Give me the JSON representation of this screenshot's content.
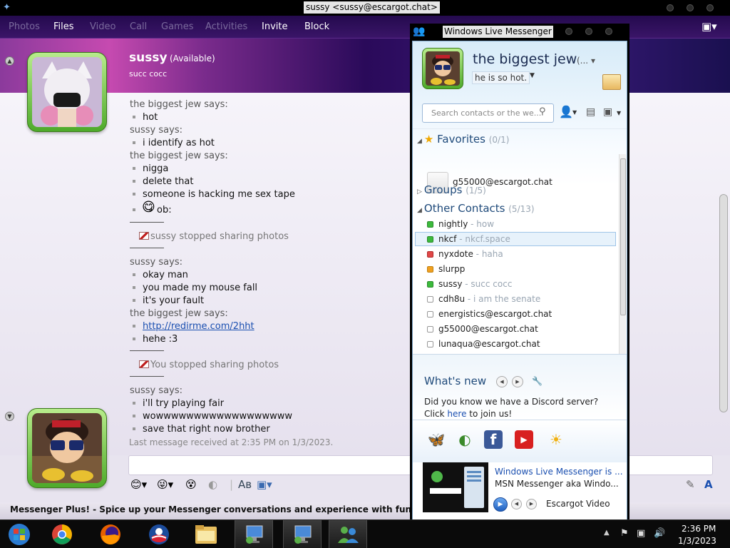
{
  "chat_window": {
    "title": "sussy <sussy@escargot.chat>",
    "menu": [
      "Photos",
      "Files",
      "Video",
      "Call",
      "Games",
      "Activities",
      "Invite",
      "Block"
    ],
    "contact": {
      "name": "sussy",
      "status": "(Available)",
      "psm": "succ cocc"
    },
    "messages": {
      "s1": "the biggest jew says:",
      "m1": "hot",
      "s2": "sussy says:",
      "m2": "i identify as hot",
      "s3": "the biggest jew says:",
      "m3": "nigga",
      "m4": "delete that",
      "m5": "someone is hacking me sex tape",
      "m6": "ob:",
      "sys1": "sussy stopped sharing photos",
      "s4": "sussy says:",
      "m7": "okay man",
      "m8": "you made my mouse fall",
      "m9": "it's your fault",
      "s5": "the biggest jew says:",
      "m10": "http://redirme.com/2hht",
      "m11": "hehe :3",
      "sys2": "You stopped sharing photos",
      "s6": "sussy says:",
      "m12": "i'll try playing fair",
      "m13": "wowwwwwwwwwwwwwwwwww",
      "m14": "save that right now brother"
    },
    "last_message": "Last message received at 2:35 PM on 1/3/2023.",
    "plus_bar": "Messenger Plus! - Spice up your Messenger conversations and experience with fun features"
  },
  "wlm": {
    "title": "Windows Live Messenger",
    "user": {
      "display_name": "the biggest jew",
      "status_short": "(...",
      "psm": "he is so hot."
    },
    "search_placeholder": "Search contacts or the we...",
    "groups": {
      "favorites": {
        "label": "Favorites",
        "count": "(0/1)"
      },
      "groups": {
        "label": "Groups",
        "count": "(1/5)"
      },
      "other": {
        "label": "Other Contacts",
        "count": "(5/13)"
      }
    },
    "favorite_contact": "g55000@escargot.chat",
    "contacts": [
      {
        "name": "nightly",
        "psm": " - how",
        "status": "online"
      },
      {
        "name": "nkcf",
        "psm": " - nkcf.space",
        "status": "online"
      },
      {
        "name": "nyxdote",
        "psm": " - haha",
        "status": "busy"
      },
      {
        "name": "slurpp",
        "psm": "",
        "status": "away"
      },
      {
        "name": "sussy",
        "psm": " - succ cocc",
        "status": "online"
      },
      {
        "name": "cdh8u",
        "psm": " - i am the senate",
        "status": "offline"
      },
      {
        "name": "energistics@escargot.chat",
        "psm": "",
        "status": "offline"
      },
      {
        "name": "g55000@escargot.chat",
        "psm": "",
        "status": "offline"
      },
      {
        "name": "lunaqua@escargot.chat",
        "psm": "",
        "status": "offline"
      }
    ],
    "whats_new": {
      "title": "What's new",
      "text": "Did you know we have a Discord server? Click ",
      "link": "here",
      "text_end": " to join us!"
    },
    "video": {
      "title": "Windows Live Messenger is ...",
      "subtitle": "MSN Messenger aka Windo...",
      "label": "Escargot Video"
    }
  },
  "taskbar": {
    "time": "2:36 PM",
    "date": "1/3/2023"
  }
}
